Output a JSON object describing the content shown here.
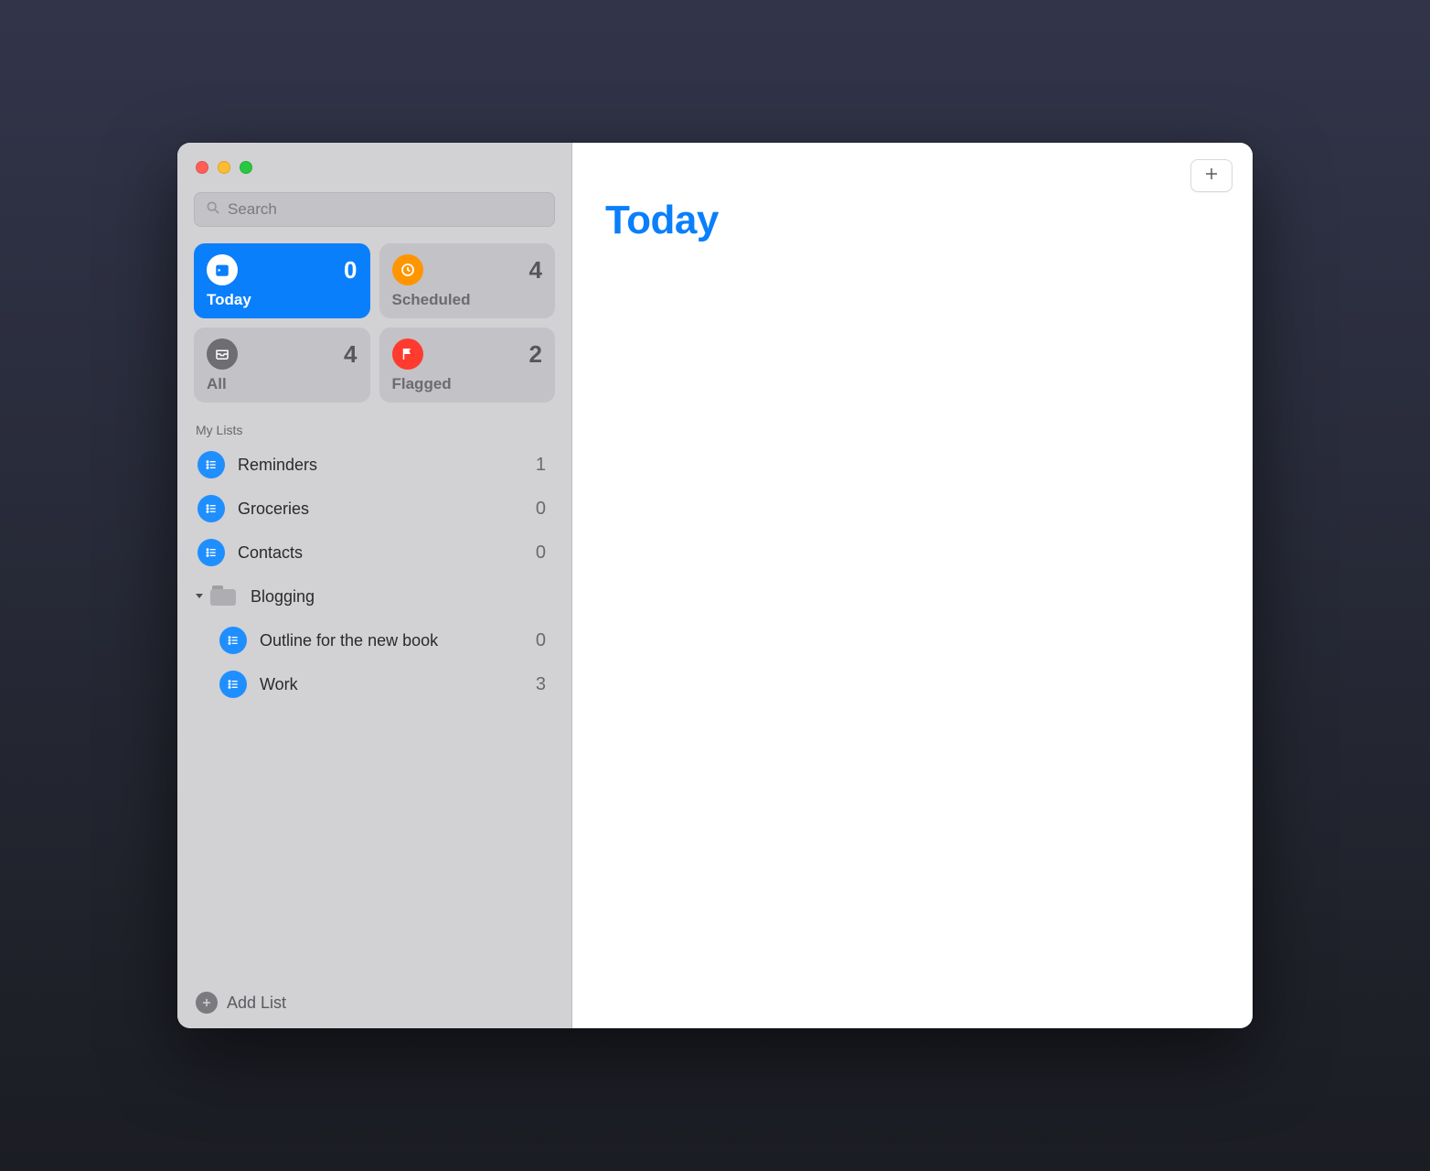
{
  "search": {
    "placeholder": "Search"
  },
  "smart": {
    "today": {
      "label": "Today",
      "count": "0"
    },
    "scheduled": {
      "label": "Scheduled",
      "count": "4"
    },
    "all": {
      "label": "All",
      "count": "4"
    },
    "flagged": {
      "label": "Flagged",
      "count": "2"
    }
  },
  "sections": {
    "my_lists": "My Lists"
  },
  "lists": {
    "reminders": {
      "name": "Reminders",
      "count": "1"
    },
    "groceries": {
      "name": "Groceries",
      "count": "0"
    },
    "contacts": {
      "name": "Contacts",
      "count": "0"
    }
  },
  "folder": {
    "blogging": {
      "name": "Blogging",
      "children": {
        "outline": {
          "name": "Outline for the new book",
          "count": "0"
        },
        "work": {
          "name": "Work",
          "count": "3"
        }
      }
    }
  },
  "footer": {
    "add_list": "Add List"
  },
  "main": {
    "title": "Today"
  }
}
